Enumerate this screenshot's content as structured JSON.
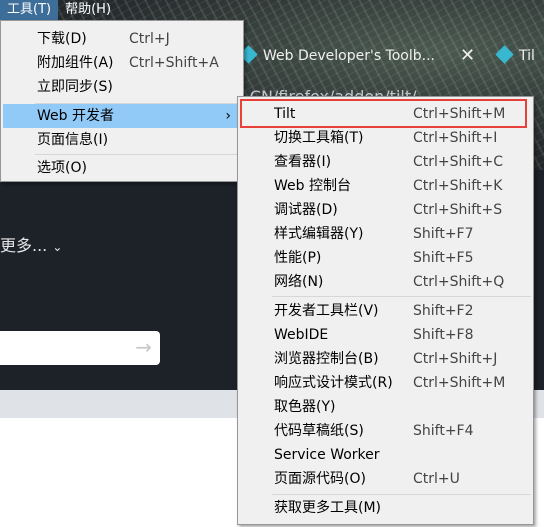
{
  "menubar": {
    "tools_label": "工具(T)",
    "help_label": "帮助(H)"
  },
  "background": {
    "tab_title": "Web Developer's Toolb...",
    "tab2_title": "Til",
    "url_fragment": "-CN/firefox/addon/tilt/",
    "more_link": "更多...",
    "search_button_icon": "arrow-right-icon"
  },
  "tools_menu": {
    "items": [
      {
        "label": "下载(D)",
        "shortcut": "Ctrl+J"
      },
      {
        "label": "附加组件(A)",
        "shortcut": "Ctrl+Shift+A"
      },
      {
        "label": "立即同步(S)",
        "shortcut": ""
      },
      {
        "label": "Web 开发者",
        "shortcut": ""
      },
      {
        "label": "页面信息(I)",
        "shortcut": ""
      },
      {
        "label": "选项(O)",
        "shortcut": ""
      }
    ]
  },
  "web_dev_menu": {
    "items": [
      {
        "label": "Tilt",
        "shortcut": "Ctrl+Shift+M"
      },
      {
        "label": "切换工具箱(T)",
        "shortcut": "Ctrl+Shift+I"
      },
      {
        "label": "查看器(I)",
        "shortcut": "Ctrl+Shift+C"
      },
      {
        "label": "Web 控制台",
        "shortcut": "Ctrl+Shift+K"
      },
      {
        "label": "调试器(D)",
        "shortcut": "Ctrl+Shift+S"
      },
      {
        "label": "样式编辑器(Y)",
        "shortcut": "Shift+F7"
      },
      {
        "label": "性能(P)",
        "shortcut": "Shift+F5"
      },
      {
        "label": "网络(N)",
        "shortcut": "Ctrl+Shift+Q"
      },
      {
        "label": "开发者工具栏(V)",
        "shortcut": "Shift+F2"
      },
      {
        "label": "WebIDE",
        "shortcut": "Shift+F8"
      },
      {
        "label": "浏览器控制台(B)",
        "shortcut": "Ctrl+Shift+J"
      },
      {
        "label": "响应式设计模式(R)",
        "shortcut": "Ctrl+Shift+M"
      },
      {
        "label": "取色器(Y)",
        "shortcut": ""
      },
      {
        "label": "代码草稿纸(S)",
        "shortcut": "Shift+F4"
      },
      {
        "label": "Service Worker",
        "shortcut": ""
      },
      {
        "label": "页面源代码(O)",
        "shortcut": "Ctrl+U"
      },
      {
        "label": "获取更多工具(M)",
        "shortcut": ""
      }
    ]
  },
  "colors": {
    "highlight": "#91c9f7",
    "annotation_box": "#e8413a",
    "menu_bg": "#f0f0f0"
  }
}
